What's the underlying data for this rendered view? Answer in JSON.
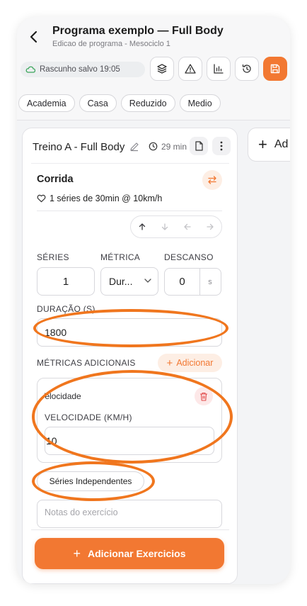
{
  "header": {
    "title": "Programa exemplo — Full Body",
    "subtitle": "Edicao de programa - Mesociclo 1",
    "status": "Rascunho salvo 19:05",
    "toolbar_icons": [
      "layers-icon",
      "warning-icon",
      "chart-icon",
      "history-icon",
      "save-icon"
    ]
  },
  "chips": [
    "Academia",
    "Casa",
    "Reduzido",
    "Medio"
  ],
  "workout": {
    "title": "Treino A - Full Body",
    "duration": "29 min"
  },
  "exercise": {
    "name": "Corrida",
    "summary": "1 séries de 30min @ 10km/h",
    "series_label": "SÉRIES",
    "series_value": "1",
    "metric_label": "MÉTRICA",
    "metric_value": "Dur...",
    "rest_label": "DESCANSO",
    "rest_value": "0",
    "rest_unit": "s",
    "duration_label": "DURAÇÃO (S)",
    "duration_value": "1800",
    "extra_metrics_label": "MÉTRICAS ADICIONAIS",
    "add_label": "Adicionar",
    "metric_card_name": "Velocidade",
    "metric_card_label": "VELOCIDADE (KM/H)",
    "metric_card_value": "10",
    "independent_series": "Séries Independentes",
    "notes_placeholder": "Notas do exercício"
  },
  "footer": {
    "add_exercises": "Adicionar Exercicios"
  },
  "side_card": {
    "label": "Ad"
  },
  "colors": {
    "accent": "#f27832",
    "annotation": "#f0761e"
  }
}
